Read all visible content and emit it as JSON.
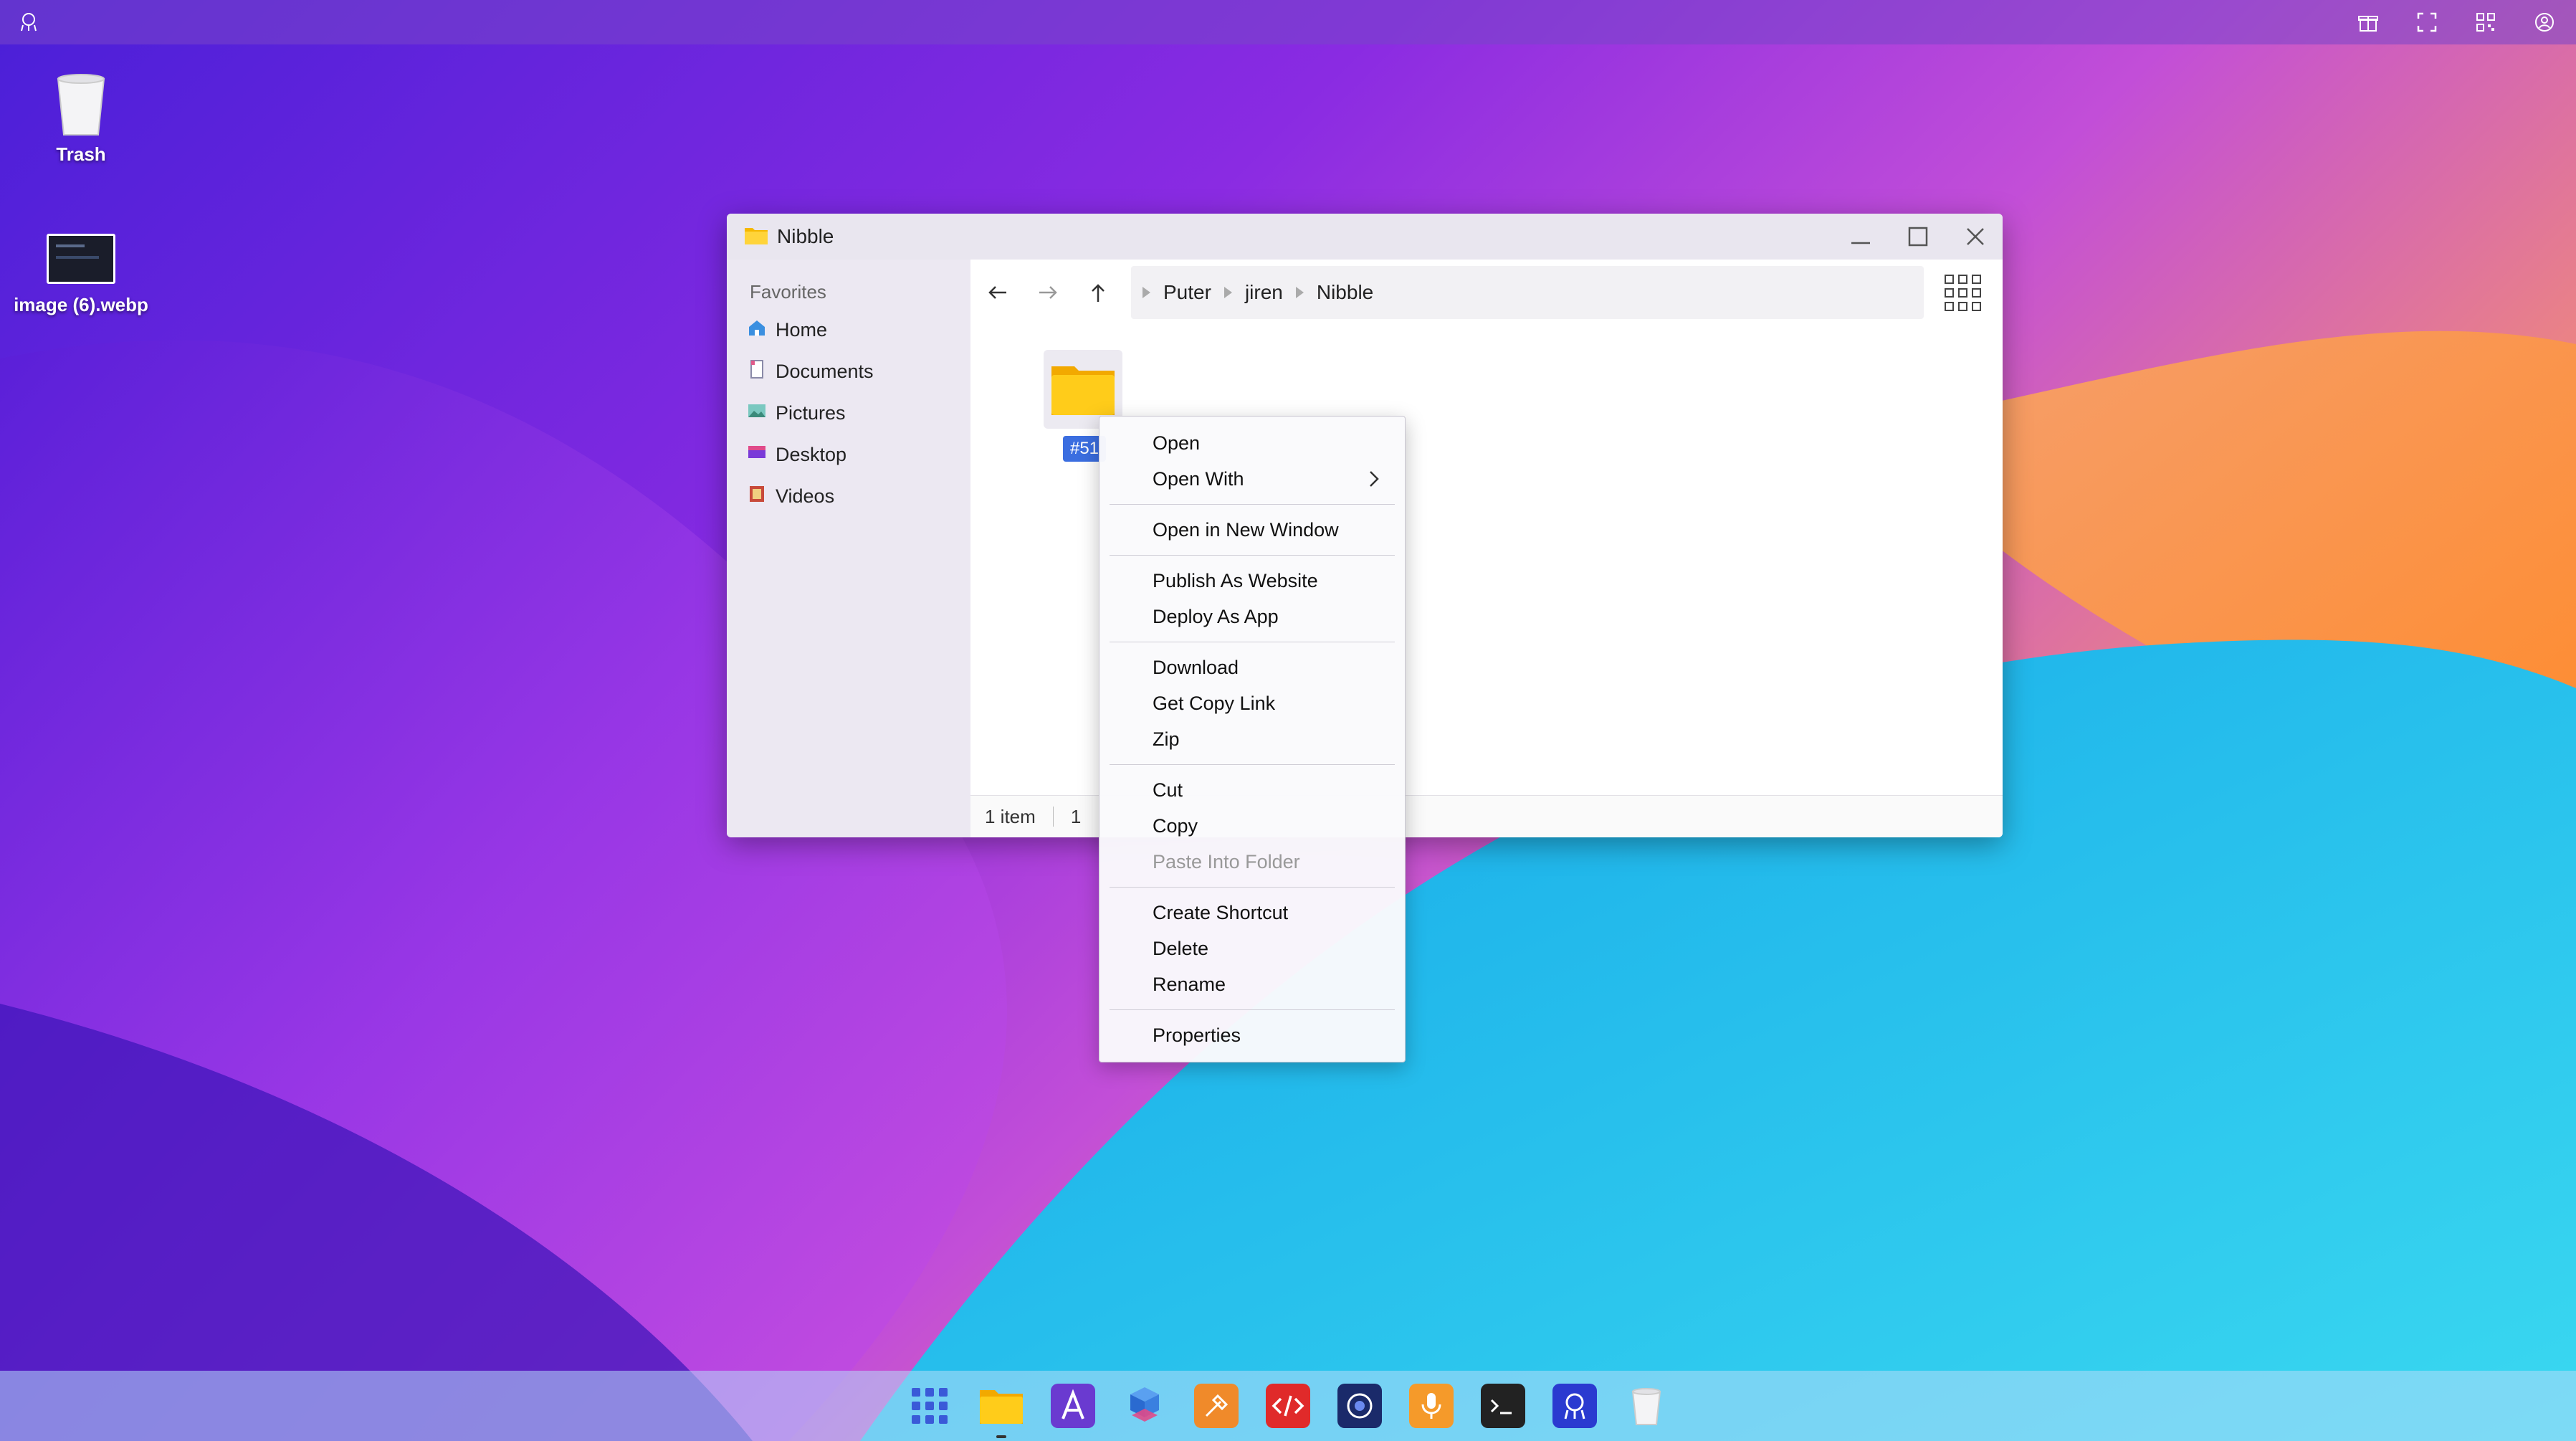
{
  "desktop": {
    "icons": [
      {
        "label": "Trash",
        "icon": "trash-icon"
      },
      {
        "label": "image (6).webp",
        "icon": "image-thumbnail-icon"
      }
    ]
  },
  "topbar": {
    "icons": [
      "puter-logo-icon",
      "gift-icon",
      "fullscreen-icon",
      "qr-code-icon",
      "user-account-icon"
    ]
  },
  "window": {
    "title": "Nibble",
    "sidebar": {
      "heading": "Favorites",
      "items": [
        {
          "label": "Home",
          "icon": "home-icon",
          "color": "#3b8fe0"
        },
        {
          "label": "Documents",
          "icon": "documents-icon",
          "color": "#8a8aa8"
        },
        {
          "label": "Pictures",
          "icon": "pictures-icon",
          "color": "#4aa8a0"
        },
        {
          "label": "Desktop",
          "icon": "desktop-icon",
          "color": "#7a3ad8"
        },
        {
          "label": "Videos",
          "icon": "videos-icon",
          "color": "#c84a3a"
        }
      ]
    },
    "breadcrumb": [
      "Puter",
      "jiren",
      "Nibble"
    ],
    "item": {
      "name": "#51",
      "icon": "folder-icon"
    },
    "status": {
      "count": "1 item",
      "selected": "1"
    }
  },
  "context_menu": {
    "groups": [
      [
        {
          "label": "Open"
        },
        {
          "label": "Open With",
          "submenu": true
        }
      ],
      [
        {
          "label": "Open in New Window"
        }
      ],
      [
        {
          "label": "Publish As Website"
        },
        {
          "label": "Deploy As App"
        }
      ],
      [
        {
          "label": "Download"
        },
        {
          "label": "Get Copy Link"
        },
        {
          "label": "Zip"
        }
      ],
      [
        {
          "label": "Cut"
        },
        {
          "label": "Copy"
        },
        {
          "label": "Paste Into Folder",
          "disabled": true
        }
      ],
      [
        {
          "label": "Create Shortcut"
        },
        {
          "label": "Delete"
        },
        {
          "label": "Rename"
        }
      ],
      [
        {
          "label": "Properties"
        }
      ]
    ]
  },
  "dock": {
    "apps": [
      {
        "name": "app-launcher-icon",
        "color": "#e9e9f2"
      },
      {
        "name": "files-icon",
        "color": "#f6c12a",
        "active": true
      },
      {
        "name": "editor-icon",
        "color": "#6a3ad0"
      },
      {
        "name": "blocks-icon",
        "color": "#3a7ae0"
      },
      {
        "name": "draw-icon",
        "color": "#f08a2a"
      },
      {
        "name": "code-icon",
        "color": "#e02a2a"
      },
      {
        "name": "camera-icon",
        "color": "#1a2a6a"
      },
      {
        "name": "recorder-icon",
        "color": "#f59a2a"
      },
      {
        "name": "terminal-icon",
        "color": "#222222"
      },
      {
        "name": "puter-icon",
        "color": "#2a3ad0"
      },
      {
        "name": "trash-icon",
        "color": "#e6e6ea"
      }
    ]
  }
}
